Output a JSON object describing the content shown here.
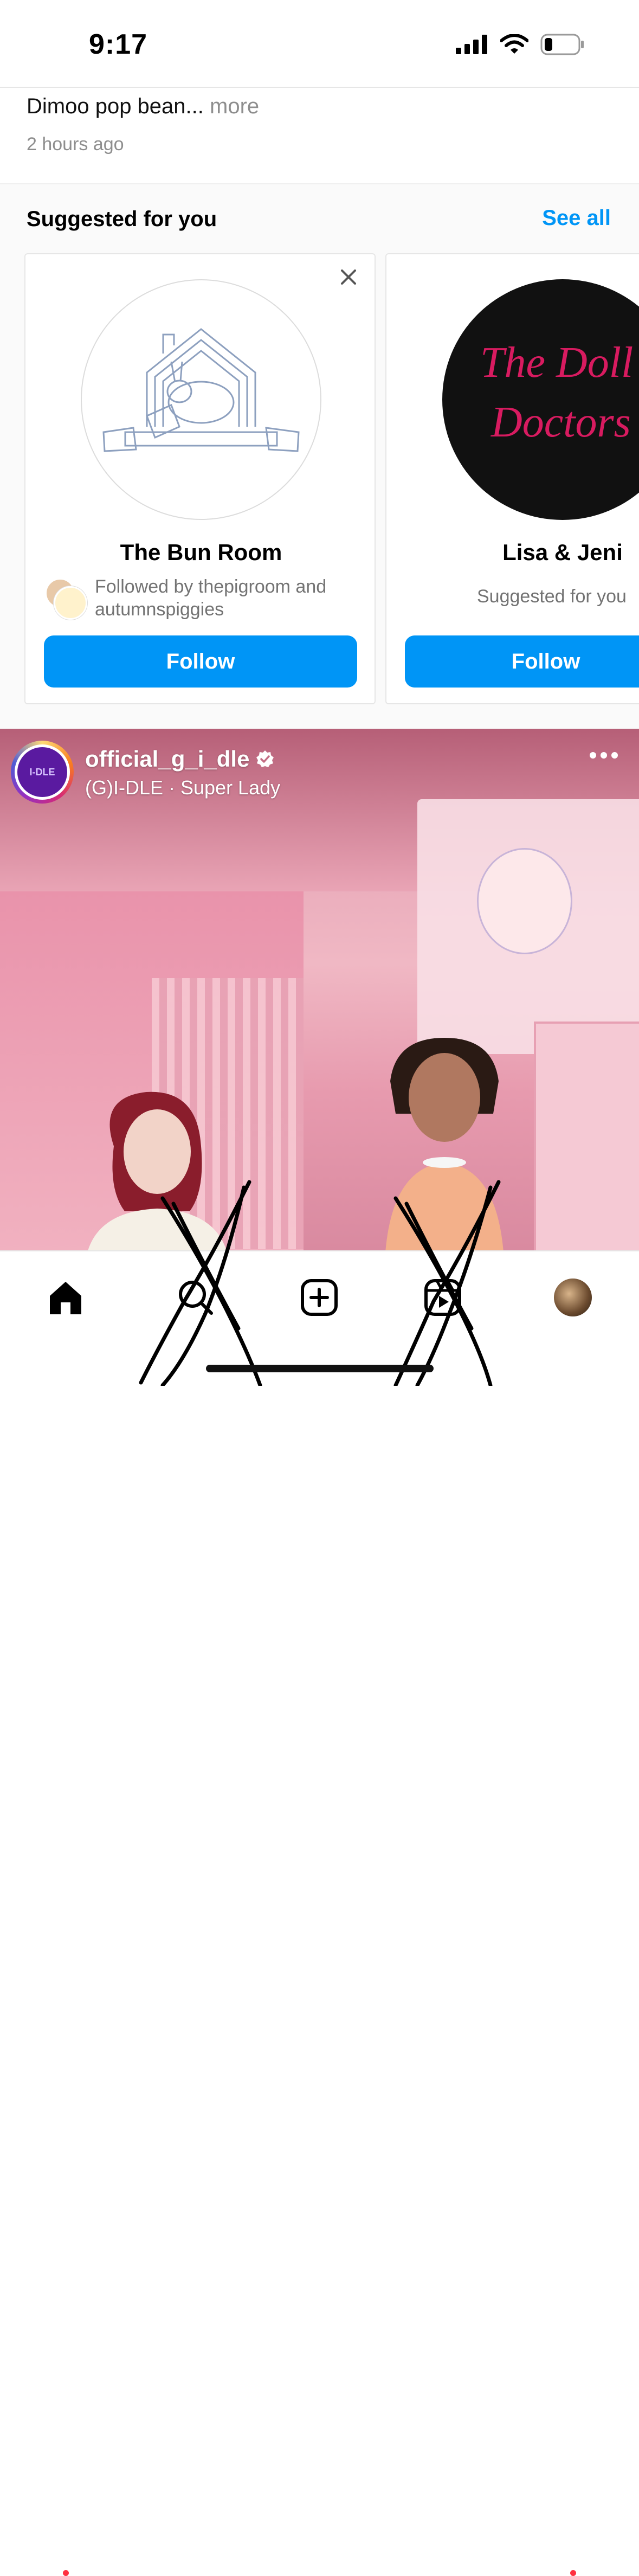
{
  "status_bar": {
    "time": "9:17"
  },
  "prev_post": {
    "caption_line": "Dimoo pop bean...",
    "more_label": "more",
    "timestamp": "2 hours ago"
  },
  "suggested": {
    "title": "Suggested for you",
    "see_all": "See all",
    "cards": [
      {
        "name": "The Bun Room",
        "subtitle": "Followed by thepigroom and autumnspiggies",
        "follow_label": "Follow"
      },
      {
        "name": "Lisa & Jeni",
        "subtitle": "Suggested for you",
        "avatar_text_line1": "The Doll",
        "avatar_text_line2": "Doctors",
        "follow_label": "Follow"
      }
    ]
  },
  "post": {
    "username": "official_g_i_dle",
    "audio": "(G)I-DLE · Super Lady",
    "avatar_text": "I-DLE"
  },
  "colors": {
    "accent": "#0095f6",
    "notification_dot": "#ff3040"
  },
  "tab_bar": {
    "icons": [
      "home-icon",
      "search-icon",
      "create-icon",
      "reels-icon",
      "profile-avatar"
    ]
  }
}
